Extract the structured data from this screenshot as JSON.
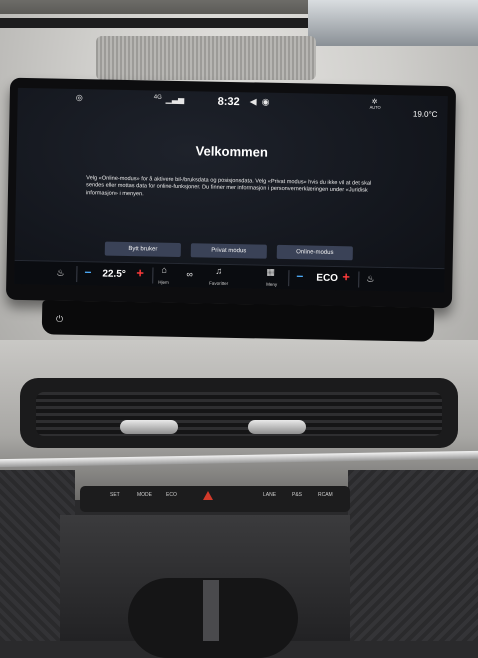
{
  "status_bar": {
    "left_icon": "location-icon",
    "signal_label": "4G",
    "time": "8:32",
    "auto_label": "AUTO",
    "outside_temp": "19.0°C"
  },
  "welcome": {
    "title": "Velkommen",
    "body": "Velg «Online-modus» for å aktivere bil-/bruksdata og posisjonsdata. Velg «Privat modus» hvis du ikke vil at det skal sendes eller mottas data for online-funksjoner. Du finner mer informasjon i personvernerklæringen under «Juridisk informasjon» i menyen."
  },
  "buttons": {
    "switch_user": "Bytt bruker",
    "private_mode": "Privat modus",
    "online_mode": "Online-modus"
  },
  "climate_bar": {
    "left_temp": "22.5°",
    "home_label": "Hjem",
    "favorites_label": "Favoritter",
    "menu_label": "Meny",
    "right_mode": "ECO"
  },
  "hardware_buttons": [
    "SET",
    "MODE",
    "ECO",
    "",
    "",
    "LANE",
    "P&S",
    "RCAM"
  ],
  "colors": {
    "minus": "#4fb0ff",
    "plus": "#ff3b3b",
    "button_bg": "#3a4257"
  }
}
